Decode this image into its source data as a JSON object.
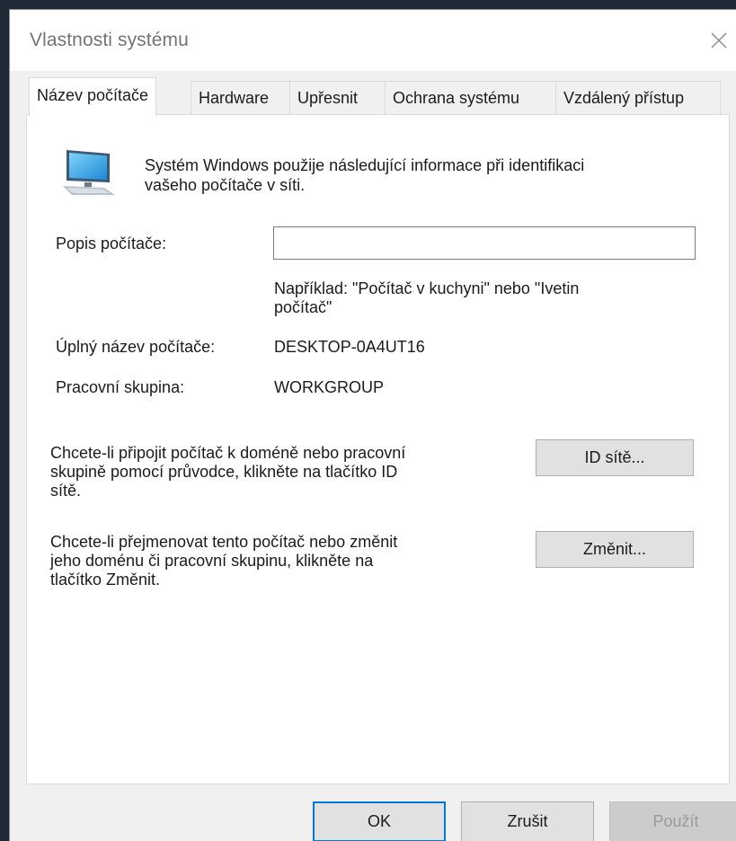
{
  "window": {
    "title": "Vlastnosti systému"
  },
  "tabs": [
    {
      "label": "Název počítače"
    },
    {
      "label": "Hardware"
    },
    {
      "label": "Upřesnit"
    },
    {
      "label": "Ochrana systému"
    },
    {
      "label": "Vzdálený přístup"
    }
  ],
  "intro": {
    "line1": "Systém Windows použije následující informace při identifikaci",
    "line2": "vašeho počítače v síti."
  },
  "description": {
    "label": "Popis počítače:",
    "value": "",
    "hint_line1": "Například: \"Počítač v kuchyni\" nebo \"Ivetin",
    "hint_line2": "počítač\""
  },
  "full_name": {
    "label": "Úplný název počítače:",
    "value": "DESKTOP-0A4UT16"
  },
  "workgroup": {
    "label": "Pracovní skupina:",
    "value": "WORKGROUP"
  },
  "network_id": {
    "text_line1": "Chcete-li připojit počítač k doméně nebo pracovní",
    "text_line2": "skupině pomocí průvodce, klikněte na tlačítko ID",
    "text_line3": "sítě.",
    "button_label": "ID sítě..."
  },
  "rename": {
    "text_line1": "Chcete-li přejmenovat tento počítač nebo změnit",
    "text_line2": "jeho doménu či pracovní skupinu, klikněte na",
    "text_line3": "tlačítko Změnit.",
    "button_label": "Změnit..."
  },
  "footer": {
    "ok_label": "OK",
    "cancel_label": "Zrušit",
    "apply_label": "Použít"
  },
  "icons": {
    "computer": "computer-monitor-icon",
    "close": "close-icon"
  },
  "colors": {
    "accent": "#0078d7",
    "window_bg": "#f0f0f0",
    "panel_bg": "#ffffff",
    "button_bg": "#e1e1e1"
  }
}
